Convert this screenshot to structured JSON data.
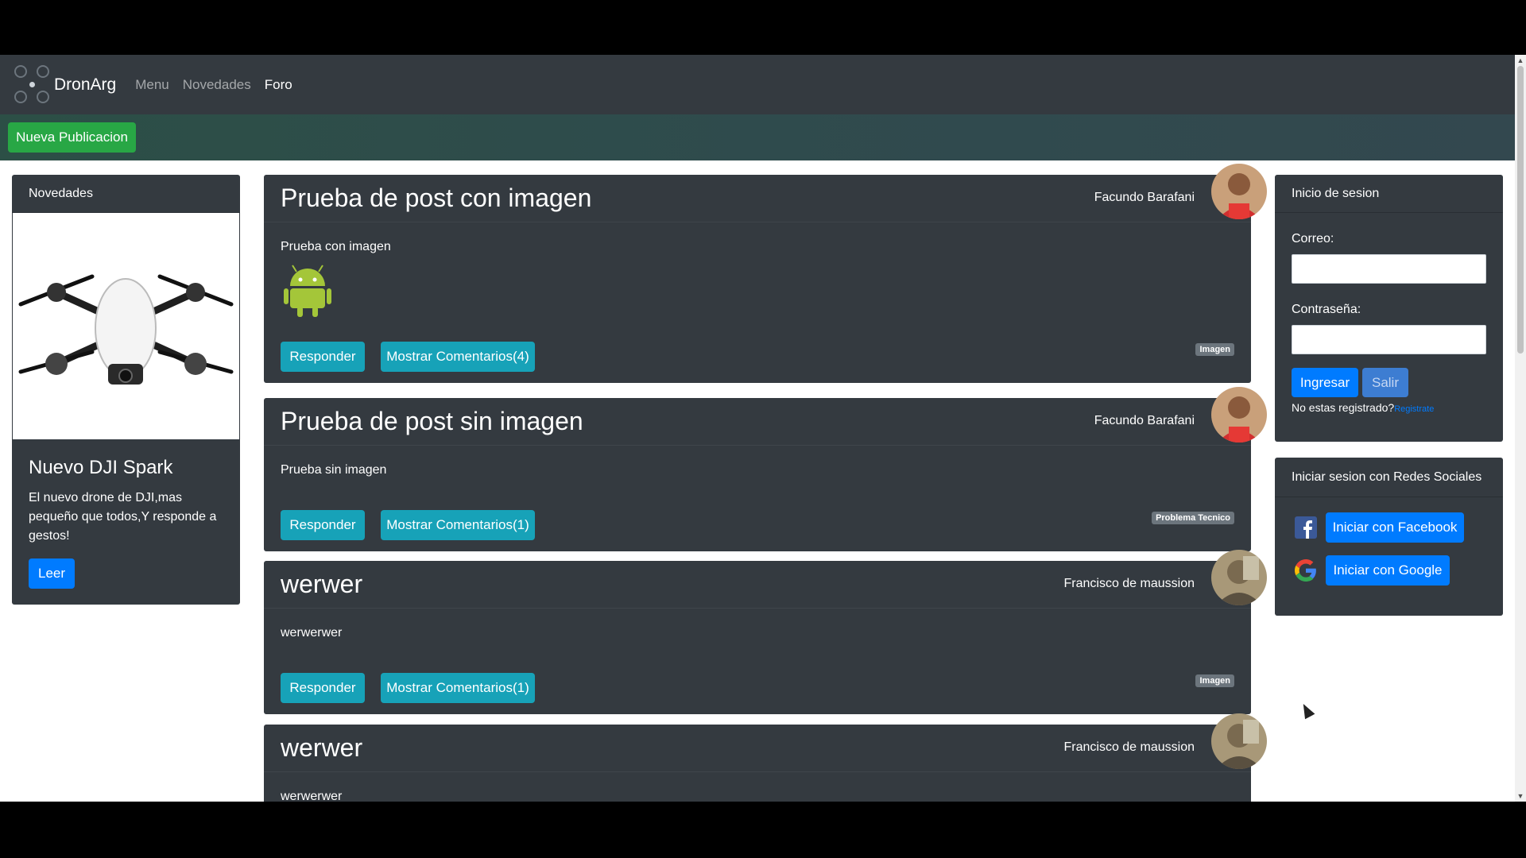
{
  "navbar": {
    "brand": "DronArg",
    "links": [
      "Menu",
      "Novedades",
      "Foro"
    ],
    "active_link": "Foro"
  },
  "toolbar": {
    "new_post_label": "Nueva Publicacion"
  },
  "news": {
    "header": "Novedades",
    "title": "Nuevo DJI Spark",
    "text": "El nuevo drone de DJI,mas pequeño que todos,Y responde a gestos!",
    "read_label": "Leer"
  },
  "posts": [
    {
      "title": "Prueba de post con imagen",
      "author": "Facundo Barafani",
      "text": "Prueba con imagen",
      "has_image": true,
      "image_icon": "android-icon",
      "reply_label": "Responder",
      "comments_label": "Mostrar Comentarios(4)",
      "tag": "Imagen"
    },
    {
      "title": "Prueba de post sin imagen",
      "author": "Facundo Barafani",
      "text": "Prueba sin imagen",
      "has_image": false,
      "reply_label": "Responder",
      "comments_label": "Mostrar Comentarios(1)",
      "tag": "Problema Tecnico"
    },
    {
      "title": "werwer",
      "author": "Francisco de maussion",
      "text": "werwerwer",
      "has_image": false,
      "reply_label": "Responder",
      "comments_label": "Mostrar Comentarios(1)",
      "tag": "Imagen"
    },
    {
      "title": "werwer",
      "author": "Francisco de maussion",
      "text": "werwerwer"
    }
  ],
  "login": {
    "header": "Inicio de sesion",
    "email_label": "Correo:",
    "password_label": "Contraseña:",
    "login_label": "Ingresar",
    "logout_label": "Salir",
    "register_prompt": "No estas registrado?",
    "register_link": "Registrate"
  },
  "social": {
    "header": "Iniciar sesion con Redes Sociales",
    "facebook_label": "Iniciar con Facebook",
    "google_label": "Iniciar con Google"
  },
  "colors": {
    "navbar": "#343a40",
    "success": "#28a745",
    "info": "#17a2b8",
    "primary": "#007bff",
    "tag": "#6c757d"
  }
}
